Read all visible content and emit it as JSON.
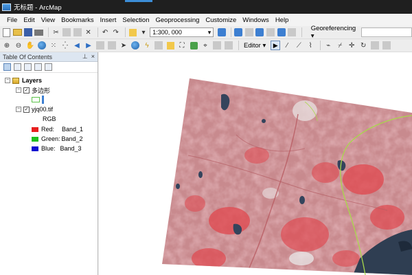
{
  "window": {
    "title": "无标题 - ArcMap"
  },
  "menu": [
    "File",
    "Edit",
    "View",
    "Bookmarks",
    "Insert",
    "Selection",
    "Geoprocessing",
    "Customize",
    "Windows",
    "Help"
  ],
  "toolbar": {
    "scale_value": "1:300, 000",
    "georeferencing_label": "Georeferencing",
    "editor_label": "Editor"
  },
  "toc": {
    "title": "Table Of Contents",
    "pin_glyph": "⊥",
    "close_glyph": "×",
    "layers_label": "Layers",
    "polygon_layer": {
      "name": "多边形"
    },
    "raster_layer": {
      "name": "yjq00.tif",
      "renderer": "RGB",
      "bands": [
        {
          "channel": "Red:",
          "band": "Band_1",
          "color": "#e81f1f"
        },
        {
          "channel": "Green:",
          "band": "Band_2",
          "color": "#20c020"
        },
        {
          "channel": "Blue:",
          "band": "Band_3",
          "color": "#1010d0"
        }
      ]
    }
  },
  "map": {
    "raster_palette": {
      "base": "#c88a8e",
      "red": "#e0474e",
      "water": "#34445c"
    },
    "polygon_outline_color": "#a8d94a"
  }
}
